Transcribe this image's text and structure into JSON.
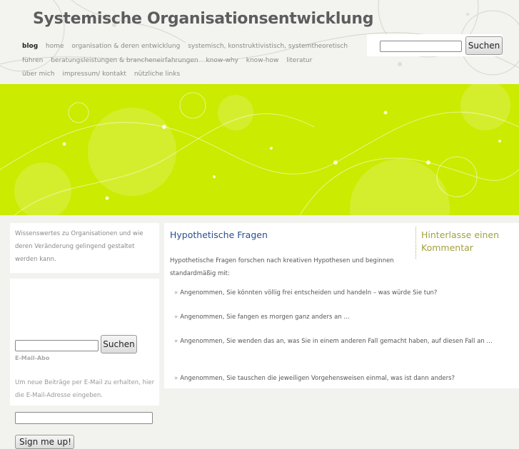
{
  "site": {
    "title": "Systemische Organisationsentwicklung"
  },
  "nav": {
    "items": [
      "blog",
      "home",
      "organisation & deren entwicklung",
      "systemisch, konstruktivistisch, systemtheoretisch führen",
      "beratungsleistungen & brancheneirfahrungen",
      "know-why",
      "know-how",
      "literatur",
      "über mich",
      "impressum/ kontakt",
      "nützliche links"
    ]
  },
  "search": {
    "button": "Suchen"
  },
  "sidebar": {
    "description": "Wissenswertes zu Organisationen und wie deren Veränderung gelingend gestaltet werden kann.",
    "search_button": "Suchen",
    "email_heading": "E-Mail-Abo",
    "email_text": "Um neue Beiträge per E-Mail zu erhalten, hier die E-Mail-Adresse eingeben.",
    "signup_button": "Sign me up!"
  },
  "post": {
    "title": "Hypothetische Fragen",
    "intro": "Hypothetische Fragen forschen nach kreativen Hypothesen und beginnen standardmäßig mit:",
    "bullet": "»",
    "items": [
      "Angenommen, Sie könnten völlig frei entscheiden und handeln – was würde Sie tun?",
      "Angenommen, Sie fangen es morgen ganz anders an …",
      "Angenommen, Sie wenden das an, was Sie in einem anderen Fall gemacht haben, auf diesen Fall an …",
      "Angenommen, Sie tauschen die jeweiligen Vorgehensweisen einmal, was ist dann anders?"
    ],
    "comment_link": "Hinterlasse einen Kommentar"
  },
  "colors": {
    "banner": "#cbeb00",
    "title_link": "#2a4e8e",
    "comment": "#a3a13f"
  }
}
